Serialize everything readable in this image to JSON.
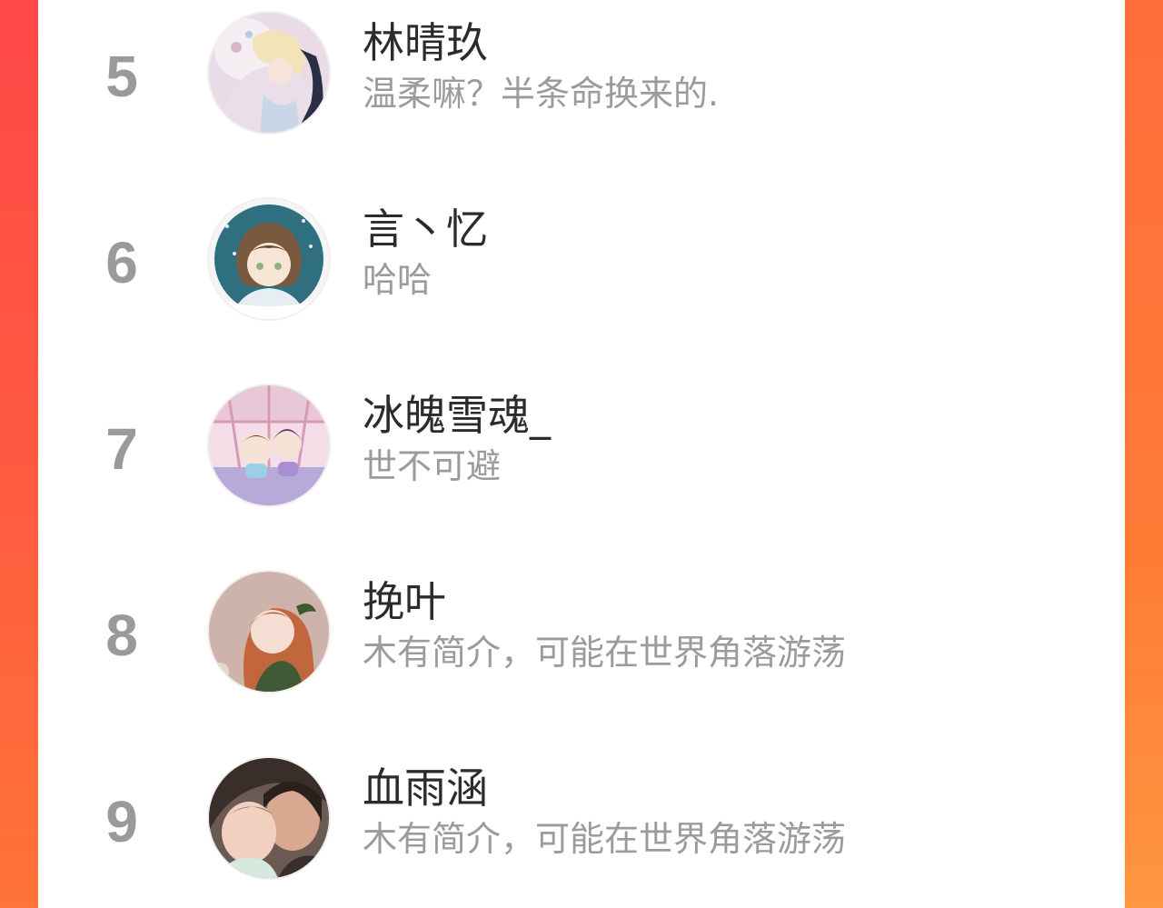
{
  "ranking": {
    "items": [
      {
        "rank": "5",
        "name": "林晴玖",
        "bio": "温柔嘛？半条命换来的.",
        "avatar_icon": "anime-avatar-icon"
      },
      {
        "rank": "6",
        "name": "言丶忆",
        "bio": "哈哈",
        "avatar_icon": "anime-avatar-icon"
      },
      {
        "rank": "7",
        "name": "冰魄雪魂_",
        "bio": "世不可避",
        "avatar_icon": "anime-avatar-icon"
      },
      {
        "rank": "8",
        "name": "挽叶",
        "bio": "木有简介，可能在世界角落游荡",
        "avatar_icon": "anime-avatar-icon"
      },
      {
        "rank": "9",
        "name": "血雨涵",
        "bio": "木有简介，可能在世界角落游荡",
        "avatar_icon": "photo-avatar-icon"
      }
    ]
  },
  "colors": {
    "background_accent": "#ff5a40",
    "rank_color": "#9a9a9a",
    "name_color": "#2b2b2b",
    "bio_color": "#9b9b9b"
  }
}
